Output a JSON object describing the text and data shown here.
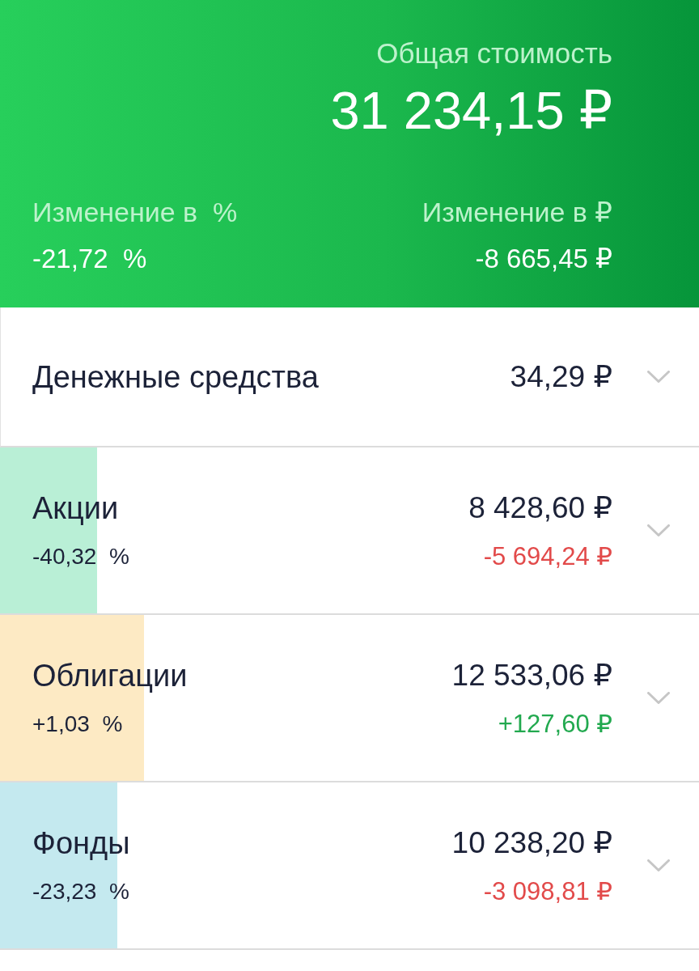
{
  "header": {
    "total_label": "Общая стоимость",
    "total_value": "31 234,15 ₽",
    "change_percent_label": "Изменение в  %",
    "change_percent_value": "-21,72  %",
    "change_rub_label": "Изменение в ₽",
    "change_rub_value": "-8 665,45 ₽"
  },
  "categories": [
    {
      "kind": "plain",
      "name": "Денежные средства",
      "value": "34,29 ₽"
    },
    {
      "kind": "detailed",
      "name": "Акции",
      "value": "8 428,60 ₽",
      "percent": "-40,32  %",
      "change": "-5 694,24 ₽",
      "positive": false,
      "color": "#b9efd6",
      "level": 0.139
    },
    {
      "kind": "detailed",
      "name": "Облигации",
      "value": "12 533,06 ₽",
      "percent": "+1,03  %",
      "change": "+127,60 ₽",
      "positive": true,
      "color": "#fdeac4",
      "level": 0.206
    },
    {
      "kind": "detailed",
      "name": "Фонды",
      "value": "10 238,20 ₽",
      "percent": "-23,23  %",
      "change": "-3 098,81 ₽",
      "positive": false,
      "color": "#c4e9ef",
      "level": 0.168
    }
  ]
}
